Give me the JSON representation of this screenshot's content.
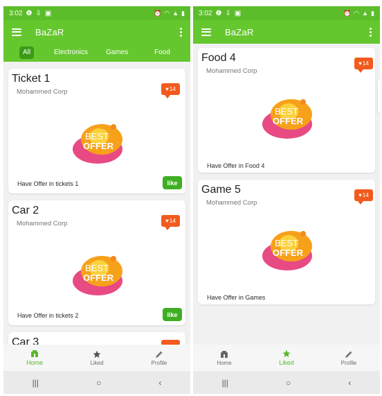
{
  "status": {
    "time": "3:02"
  },
  "app": {
    "title": "BaZaR"
  },
  "tabs": [
    {
      "label": "All"
    },
    {
      "label": "Electronics"
    },
    {
      "label": "Games"
    },
    {
      "label": "Food"
    }
  ],
  "left_cards": [
    {
      "title": "Ticket 1",
      "company": "Mohammed Corp",
      "description": "Have Offer in tickets 1",
      "likes": "14",
      "like_label": "like"
    },
    {
      "title": "Car 2",
      "company": "Mohammed Corp",
      "description": "Have Offer in tickets 2",
      "likes": "14",
      "like_label": "like"
    },
    {
      "title": "Car 3"
    }
  ],
  "right_cards": [
    {
      "title": "Food 4",
      "company": "Mohammed Corp",
      "description": "Have Offer in Food 4",
      "likes": "14"
    },
    {
      "title": "Game 5",
      "company": "Mohammed Corp",
      "description": "Have Offer in Games",
      "likes": "14"
    }
  ],
  "offer_art": {
    "line1": "BEST",
    "line2": "OFFER"
  },
  "bottom_nav": [
    {
      "label": "Home",
      "icon": "home-icon"
    },
    {
      "label": "Liked",
      "icon": "star-icon"
    },
    {
      "label": "Profile",
      "icon": "pencil-icon"
    }
  ],
  "system_nav": {
    "recents": "|||",
    "home": "○",
    "back": "‹"
  },
  "colors": {
    "primary": "#65c72e",
    "status_bar": "#5cbd2a",
    "accent": "#f25b1d",
    "like_button": "#3fae23",
    "active_nav": "#58b82a"
  }
}
